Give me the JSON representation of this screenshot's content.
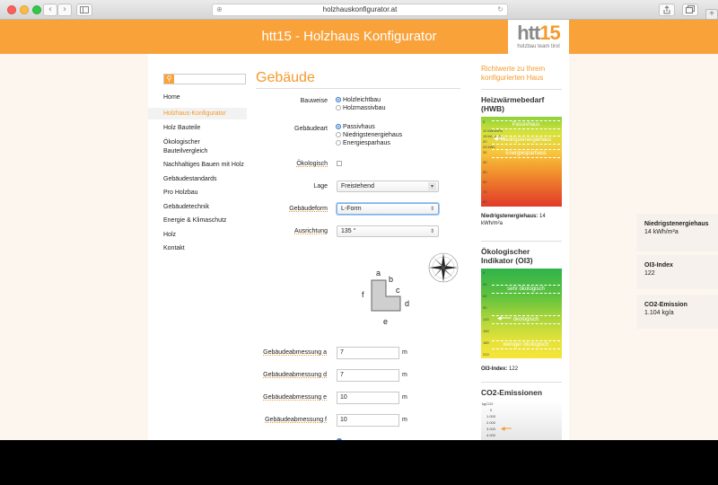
{
  "browser": {
    "url": "holzhauskonfigurator.at",
    "back_glyph": "‹",
    "forward_glyph": "›"
  },
  "header": {
    "title": "htt15 - Holzhaus Konfigurator",
    "logo_main_a": "htt",
    "logo_main_b": "15",
    "logo_sub": "holzbau team tirol",
    "accent": "#f9a23a"
  },
  "sidebar": {
    "search_placeholder": "",
    "items": [
      {
        "label": "Home"
      },
      {
        "label": "Holzhaus-Konfigurator",
        "active": true
      },
      {
        "label": "Holz Bauteile"
      },
      {
        "label": "Ökologischer Bauteilvergleich"
      },
      {
        "label": "Nachhaltiges Bauen mit Holz"
      },
      {
        "label": "Gebäudestandards"
      },
      {
        "label": "Pro Holzbau"
      },
      {
        "label": "Gebäudetechnik"
      },
      {
        "label": "Energie & Klimaschutz"
      },
      {
        "label": "Holz"
      },
      {
        "label": "Kontakt"
      }
    ]
  },
  "main": {
    "heading": "Gebäude",
    "bauweise": {
      "label": "Bauweise",
      "options": [
        "Holzleichtbau",
        "Holzmassivbau"
      ],
      "selected": 0
    },
    "gebaeudeart": {
      "label": "Gebäudeart",
      "options": [
        "Passivhaus",
        "Niedrigstenergiehaus",
        "Energiesparhaus"
      ],
      "selected": 0
    },
    "oekologisch": {
      "label": "Ökologisch",
      "checked": false
    },
    "lage": {
      "label": "Lage",
      "value": "Freistehend"
    },
    "gebaeudeform": {
      "label": "Gebäudeform",
      "value": "L-Form"
    },
    "ausrichtung": {
      "label": "Ausrichtung",
      "value": "135 °"
    },
    "shape_labels": {
      "a": "a",
      "b": "b",
      "c": "c",
      "d": "d",
      "e": "e",
      "f": "f"
    },
    "dimensions": [
      {
        "label": "Gebäudeabmessung a",
        "value": "7",
        "unit": "m"
      },
      {
        "label": "Gebäudeabmessung d",
        "value": "7",
        "unit": "m"
      },
      {
        "label": "Gebäudeabmessung e",
        "value": "10",
        "unit": "m"
      },
      {
        "label": "Gebäudeabmessung f",
        "value": "10",
        "unit": "m"
      }
    ]
  },
  "right": {
    "title": "Richtwerte zu Ihrem konfigurierten Haus",
    "hwb": {
      "heading": "Heizwärmebedarf (HWB)",
      "ticks": [
        "0",
        "10 kWh/m²a",
        "15 kWh/m²a",
        "20",
        "25 kWh",
        "30",
        "40",
        "50",
        "60",
        "70",
        "80"
      ],
      "bands": [
        "Passivhaus",
        "Niedrigstenergiehaus",
        "Energiesparhaus"
      ],
      "note_label": "Niedrigstenergiehaus:",
      "note_value": "14 kWh/m²a"
    },
    "oi3": {
      "heading": "Ökologischer Indikator (OI3)",
      "ticks": [
        "0",
        "30",
        "60",
        "90",
        "120",
        "150",
        "180",
        "210"
      ],
      "bands": [
        "sehr ökologisch",
        "ökologisch",
        "weniger ökologisch"
      ],
      "note_label": "OI3-Index:",
      "note_value": "122"
    },
    "co2": {
      "heading": "CO2-Emissionen",
      "unit": "kgCO2",
      "ticks": [
        "0",
        "1.000",
        "2.000",
        "3.000",
        "4.000"
      ]
    }
  },
  "cards": [
    {
      "title": "Niedrigstenergiehaus",
      "value": "14 kWh/m²a"
    },
    {
      "title": "OI3-Index",
      "value": "122"
    },
    {
      "title": "CO2-Emission",
      "value": "1.104 kg/a"
    }
  ],
  "colors": {
    "accent": "#f49a2c",
    "radio_on": "#3b8de6"
  }
}
